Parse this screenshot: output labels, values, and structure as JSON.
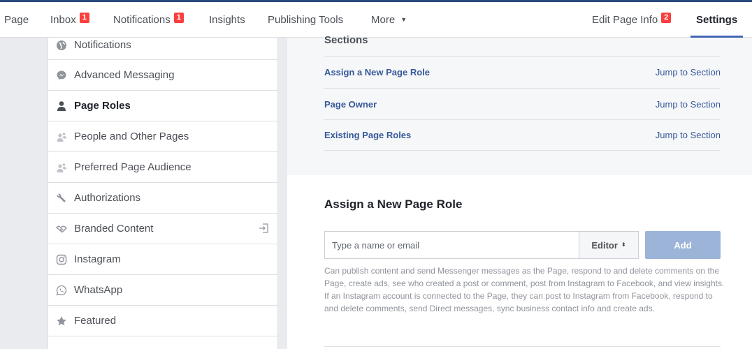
{
  "topnav": {
    "items": [
      {
        "label": "Page"
      },
      {
        "label": "Inbox",
        "badge": "1"
      },
      {
        "label": "Notifications",
        "badge": "1"
      },
      {
        "label": "Insights"
      },
      {
        "label": "Publishing Tools"
      },
      {
        "label": "More",
        "caret": "▼"
      }
    ],
    "edit_page_info": {
      "label": "Edit Page Info",
      "badge": "2"
    },
    "settings": {
      "label": "Settings"
    }
  },
  "sidebar": {
    "items": [
      {
        "label": "Notifications",
        "icon": "globe-icon"
      },
      {
        "label": "Advanced Messaging",
        "icon": "messenger-icon"
      },
      {
        "label": "Page Roles",
        "icon": "person-icon",
        "active": true
      },
      {
        "label": "People and Other Pages",
        "icon": "people-icon"
      },
      {
        "label": "Preferred Page Audience",
        "icon": "people-icon"
      },
      {
        "label": "Authorizations",
        "icon": "wrench-icon"
      },
      {
        "label": "Branded Content",
        "icon": "handshake-icon",
        "extra_icon": "login-arrow-icon"
      },
      {
        "label": "Instagram",
        "icon": "instagram-icon"
      },
      {
        "label": "WhatsApp",
        "icon": "whatsapp-icon"
      },
      {
        "label": "Featured",
        "icon": "star-icon"
      }
    ]
  },
  "sections": {
    "title": "Sections",
    "rows": [
      {
        "label": "Assign a New Page Role",
        "jump": "Jump to Section"
      },
      {
        "label": "Page Owner",
        "jump": "Jump to Section"
      },
      {
        "label": "Existing Page Roles",
        "jump": "Jump to Section"
      }
    ]
  },
  "assign": {
    "title": "Assign a New Page Role",
    "input_placeholder": "Type a name or email",
    "role_value": "Editor",
    "role_caret": "⬍",
    "add_label": "Add",
    "description": "Can publish content and send Messenger messages as the Page, respond to and delete comments on the Page, create ads, see who created a post or comment, post from Instagram to Facebook, and view insights. If an Instagram account is connected to the Page, they can post to Instagram from Facebook, respond to and delete comments, send Direct messages, sync business contact info and create ads."
  },
  "colors": {
    "accent": "#4267b2",
    "link": "#365899",
    "badge": "#fa3e3e",
    "add_button": "#9cb4d8"
  }
}
